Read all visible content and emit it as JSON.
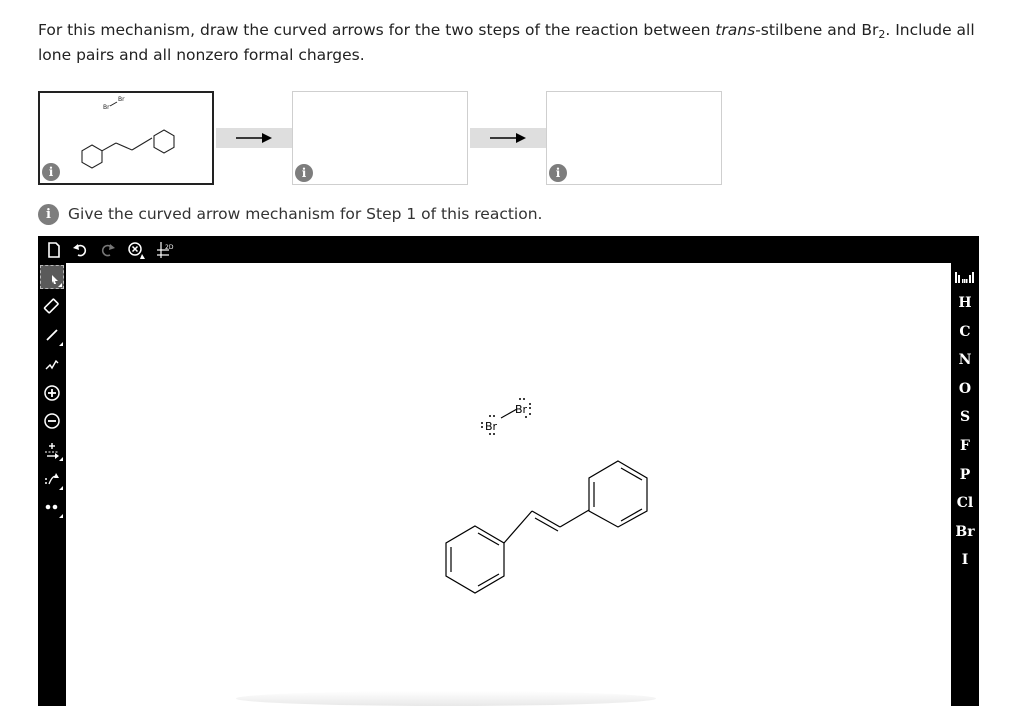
{
  "question": {
    "prefix": "For this mechanism, draw the curved arrows for the two steps of the reaction between ",
    "italic": "trans",
    "middle": "-stilbene and Br",
    "subscript": "2",
    "suffix": ". Include all lone pairs and all nonzero formal charges."
  },
  "steps": {
    "info_glyph": "i",
    "boxes": [
      "step-1",
      "step-2",
      "step-3"
    ]
  },
  "prompt": {
    "info_glyph": "i",
    "text": "Give the curved arrow mechanism for Step 1 of this reaction."
  },
  "editor": {
    "top_tools": [
      "new-document-icon",
      "undo-icon",
      "redo-icon",
      "zoom-clear-icon",
      "2d-clean-icon"
    ],
    "clean_label": "2D",
    "left_tools": [
      "select-tool-icon",
      "eraser-icon",
      "bond-icon",
      "chain-icon",
      "plus-charge-icon",
      "minus-charge-icon",
      "electron-arrow-icon",
      "curved-arrow-icon",
      "lone-pair-icon"
    ],
    "periodic_table_icon": "periodic-table-icon",
    "elements": [
      "H",
      "C",
      "N",
      "O",
      "S",
      "F",
      "P",
      "Cl",
      "Br",
      "I"
    ],
    "molecule": {
      "br_label": "Br",
      "lone_pair_glyph": "••"
    }
  },
  "colors": {
    "toolbar": "#000000",
    "info": "#7d7d7d",
    "arrow_bar": "#dedede"
  }
}
